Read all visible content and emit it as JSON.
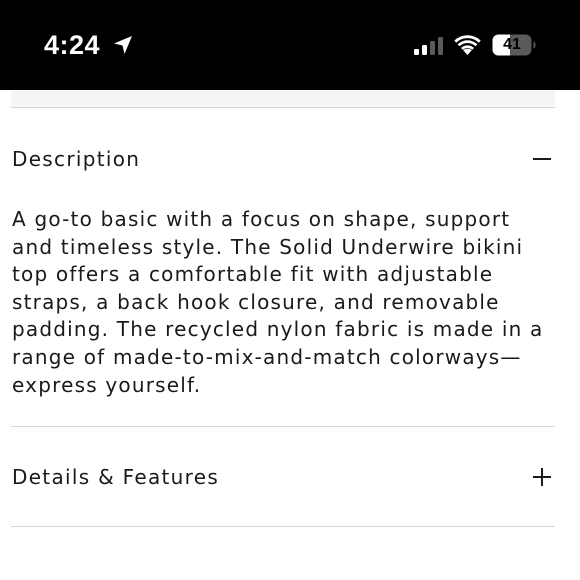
{
  "status_bar": {
    "time": "4:24",
    "battery_level": "41",
    "icons": [
      "location-arrow-icon",
      "cellular-signal-icon",
      "wifi-icon",
      "battery-icon"
    ]
  },
  "accordion": {
    "description": {
      "title": "Description",
      "state_icon": "minus-icon",
      "expanded": true,
      "body": "A go-to basic with a focus on shape, support and timeless style. The Solid Underwire bikini top offers a comfortable fit with adjustable straps, a back hook closure, and removable padding. The recycled nylon fabric is made in a range of made-to-mix-and-match colorways—express yourself."
    },
    "details": {
      "title": "Details & Features",
      "state_icon": "plus-icon",
      "expanded": false
    }
  }
}
